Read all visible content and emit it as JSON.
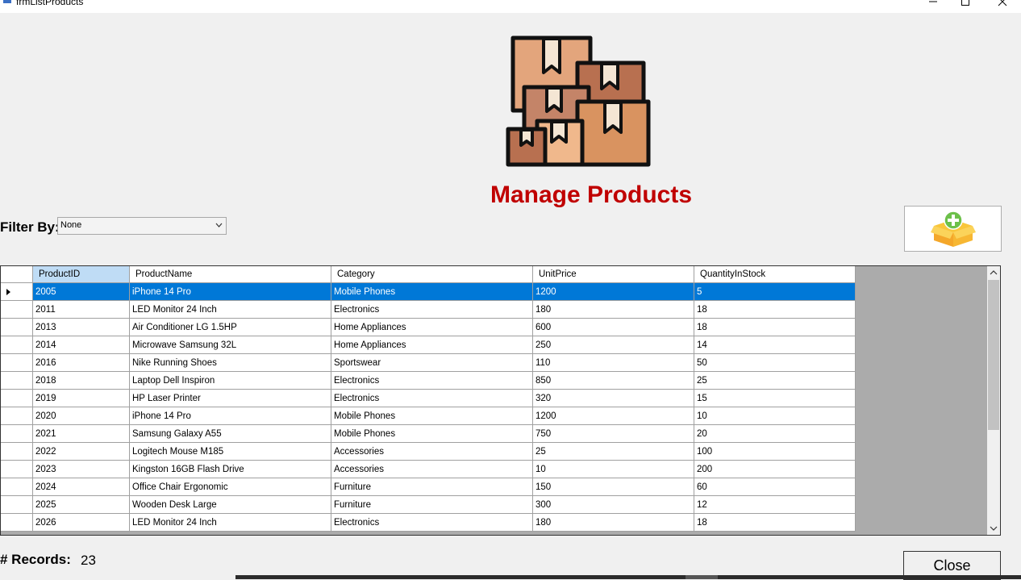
{
  "window": {
    "title": "frmListProducts",
    "minimize_icon": "minimize-icon",
    "maximize_icon": "maximize-icon",
    "close_icon": "close-icon"
  },
  "header": {
    "logo_icon": "boxes-logo-icon",
    "title": "Manage Products",
    "title_color": "#c00000"
  },
  "filter": {
    "label": "Filter By:",
    "selected": "None"
  },
  "add_button": {
    "icon": "add-product-box-icon"
  },
  "grid": {
    "columns": [
      "ProductID",
      "ProductName",
      "Category",
      "UnitPrice",
      "QuantityInStock"
    ],
    "selected_row": 0,
    "selection_color": "#0078d7",
    "rows": [
      [
        "2005",
        "iPhone 14 Pro",
        "Mobile Phones",
        "1200",
        "5"
      ],
      [
        "2011",
        "LED Monitor 24 Inch",
        "Electronics",
        "180",
        "18"
      ],
      [
        "2013",
        "Air Conditioner LG 1.5HP",
        "Home Appliances",
        "600",
        "18"
      ],
      [
        "2014",
        "Microwave Samsung 32L",
        "Home Appliances",
        "250",
        "14"
      ],
      [
        "2016",
        "Nike Running Shoes",
        "Sportswear",
        "110",
        "50"
      ],
      [
        "2018",
        "Laptop Dell Inspiron",
        "Electronics",
        "850",
        "25"
      ],
      [
        "2019",
        "HP Laser Printer",
        "Electronics",
        "320",
        "15"
      ],
      [
        "2020",
        "iPhone 14 Pro",
        "Mobile Phones",
        "1200",
        "10"
      ],
      [
        "2021",
        "Samsung Galaxy A55",
        "Mobile Phones",
        "750",
        "20"
      ],
      [
        "2022",
        "Logitech Mouse M185",
        "Accessories",
        "25",
        "100"
      ],
      [
        "2023",
        "Kingston 16GB Flash Drive",
        "Accessories",
        "10",
        "200"
      ],
      [
        "2024",
        "Office Chair Ergonomic",
        "Furniture",
        "150",
        "60"
      ],
      [
        "2025",
        "Wooden Desk Large",
        "Furniture",
        "300",
        "12"
      ],
      [
        "2026",
        "LED Monitor 24 Inch",
        "Electronics",
        "180",
        "18"
      ]
    ]
  },
  "footer": {
    "records_label": "# Records:",
    "records_count": "23",
    "close_label": "Close"
  }
}
